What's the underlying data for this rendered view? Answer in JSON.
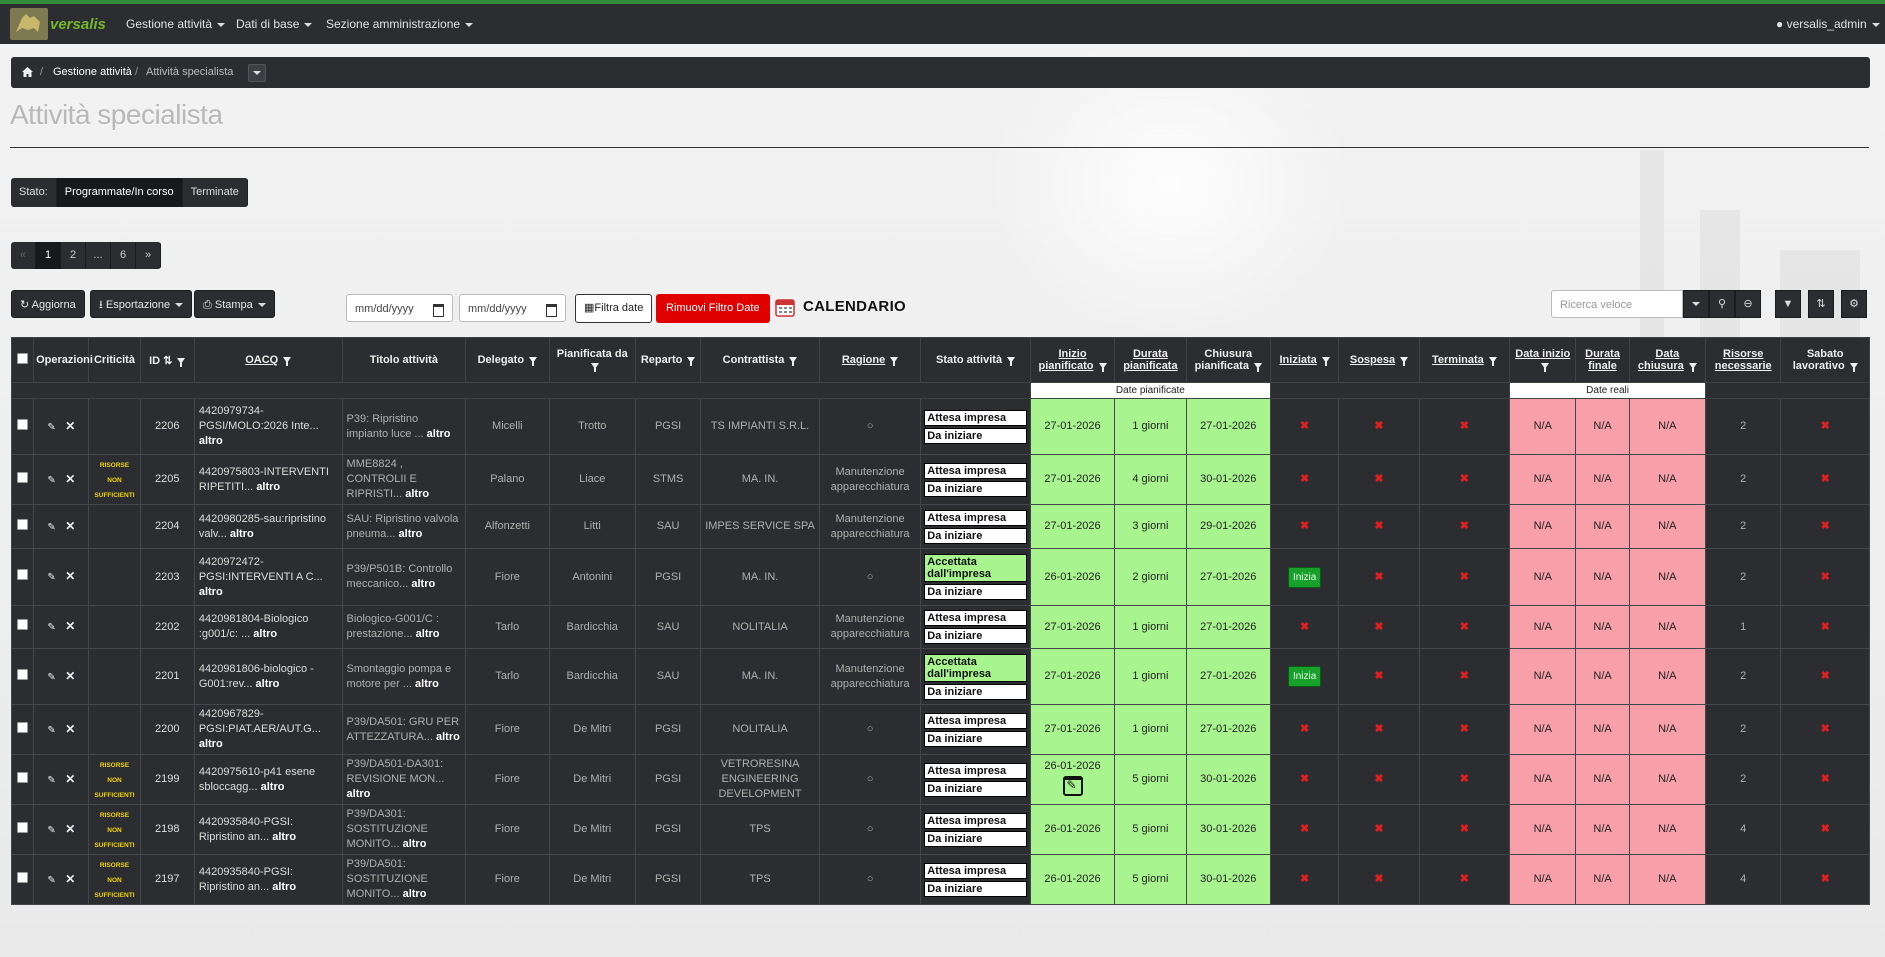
{
  "nav": {
    "brand": "versalis",
    "menus": [
      "Gestione attività",
      "Dati di base",
      "Sezione amministrazione"
    ],
    "user": "versalis_admin"
  },
  "breadcrumb": {
    "items": [
      "Gestione attività",
      "Attività specialista"
    ]
  },
  "page": {
    "title": "Attività specialista"
  },
  "stato": {
    "label": "Stato:",
    "options": [
      "Programmate/In corso",
      "Terminate"
    ],
    "selected": "Programmate/In corso"
  },
  "pager": {
    "prev": "«",
    "pages": [
      "1",
      "2",
      "...",
      "6"
    ],
    "next": "»",
    "current": "1"
  },
  "toolbar": {
    "aggiorna": "Aggiorna",
    "esportazione": "Esportazione",
    "stampa": "Stampa",
    "date_placeholder_from": "mm/dd/yyyy",
    "date_placeholder_to": "mm/dd/yyyy",
    "filtra_date": "Filtra date",
    "rimuovi_filtro": "Rimuovi Filtro Date",
    "calendario": "CALENDARIO",
    "search_placeholder": "Ricerca veloce"
  },
  "table": {
    "headers": [
      "Operazioni",
      "Criticità",
      "ID",
      "OACQ",
      "Titolo attività",
      "Delegato",
      "Pianificata da",
      "Reparto",
      "Contrattista",
      "Ragione",
      "Stato attività",
      "Inizio pianificato",
      "Durata pianificata",
      "Chiusura pianificata",
      "Iniziata",
      "Sospesa",
      "Terminata",
      "Data inizio",
      "Durata finale",
      "Data chiusura",
      "Risorse necessarie",
      "Sabato lavorativo"
    ],
    "group_planned": "Date pianificate",
    "group_real": "Date reali",
    "altro": "altro",
    "risorse_text": "RISORSE NON SUFFICIENTI",
    "rows": [
      {
        "id": "2206",
        "risorse": false,
        "oacq": "4420979734-PGSI/MOLO:2026 Inte...",
        "titolo": "P39: Ripristino impianto luce ...",
        "delegato": "Micelli",
        "pianificata": "Trotto",
        "reparto": "PGSI",
        "contrattista": "TS IMPIANTI S.R.L.",
        "ragione": "○",
        "stato1": "Attesa impresa",
        "stato2": "Da iniziare",
        "stato1_green": false,
        "inizio": "27-01-2026",
        "durata": "1 giorni",
        "chiusura": "27-01-2026",
        "iniziata_btn": false,
        "data_inizio": "N/A",
        "durata_finale": "N/A",
        "data_chiusura": "N/A",
        "risorse_n": "2"
      },
      {
        "id": "2205",
        "risorse": true,
        "oacq": "4420975803-INTERVENTI RIPETITI...",
        "titolo": "MME8824 , CONTROLII E RIPRISTI...",
        "delegato": "Palano",
        "pianificata": "Liace",
        "reparto": "STMS",
        "contrattista": "MA. IN.",
        "ragione": "Manutenzione apparecchiatura",
        "stato1": "Attesa impresa",
        "stato2": "Da iniziare",
        "stato1_green": false,
        "inizio": "27-01-2026",
        "durata": "4 giorni",
        "chiusura": "30-01-2026",
        "iniziata_btn": false,
        "data_inizio": "N/A",
        "durata_finale": "N/A",
        "data_chiusura": "N/A",
        "risorse_n": "2"
      },
      {
        "id": "2204",
        "risorse": false,
        "oacq": "4420980285-sau:ripristino valv...",
        "titolo": "SAU: Ripristino valvola pneuma...",
        "delegato": "Alfonzetti",
        "pianificata": "Litti",
        "reparto": "SAU",
        "contrattista": "IMPES SERVICE SPA",
        "ragione": "Manutenzione apparecchiatura",
        "stato1": "Attesa impresa",
        "stato2": "Da iniziare",
        "stato1_green": false,
        "inizio": "27-01-2026",
        "durata": "3 giorni",
        "chiusura": "29-01-2026",
        "iniziata_btn": false,
        "data_inizio": "N/A",
        "durata_finale": "N/A",
        "data_chiusura": "N/A",
        "risorse_n": "2"
      },
      {
        "id": "2203",
        "risorse": false,
        "oacq": "4420972472-PGSI:INTERVENTI A C...",
        "titolo": "P39/P501B: Controllo meccanico...",
        "delegato": "Fiore",
        "pianificata": "Antonini",
        "reparto": "PGSI",
        "contrattista": "MA. IN.",
        "ragione": "○",
        "stato1": "Accettata dall'impresa",
        "stato2": "Da iniziare",
        "stato1_green": true,
        "inizio": "26-01-2026",
        "durata": "2 giorni",
        "chiusura": "27-01-2026",
        "iniziata_btn": true,
        "data_inizio": "N/A",
        "durata_finale": "N/A",
        "data_chiusura": "N/A",
        "risorse_n": "2"
      },
      {
        "id": "2202",
        "risorse": false,
        "oacq": "4420981804-Biologico :g001/c: ...",
        "titolo": "Biologico-G001/C : prestazione...",
        "delegato": "Tarlo",
        "pianificata": "Bardicchia",
        "reparto": "SAU",
        "contrattista": "NOLITALIA",
        "ragione": "Manutenzione apparecchiatura",
        "stato1": "Attesa impresa",
        "stato2": "Da iniziare",
        "stato1_green": false,
        "inizio": "27-01-2026",
        "durata": "1 giorni",
        "chiusura": "27-01-2026",
        "iniziata_btn": false,
        "data_inizio": "N/A",
        "durata_finale": "N/A",
        "data_chiusura": "N/A",
        "risorse_n": "1"
      },
      {
        "id": "2201",
        "risorse": false,
        "oacq": "4420981806-biologico - G001:rev...",
        "titolo": "Smontaggio pompa e motore per ...",
        "delegato": "Tarlo",
        "pianificata": "Bardicchia",
        "reparto": "SAU",
        "contrattista": "MA. IN.",
        "ragione": "Manutenzione apparecchiatura",
        "stato1": "Accettata dall'impresa",
        "stato2": "Da iniziare",
        "stato1_green": true,
        "inizio": "27-01-2026",
        "durata": "1 giorni",
        "chiusura": "27-01-2026",
        "iniziata_btn": true,
        "data_inizio": "N/A",
        "durata_finale": "N/A",
        "data_chiusura": "N/A",
        "risorse_n": "2"
      },
      {
        "id": "2200",
        "risorse": false,
        "oacq": "4420967829-PGSI:PIAT.AER/AUT.G...",
        "titolo": "P39/DA501: GRU PER ATTEZZATURA...",
        "delegato": "Fiore",
        "pianificata": "De Mitri",
        "reparto": "PGSI",
        "contrattista": "NOLITALIA",
        "ragione": "○",
        "stato1": "Attesa impresa",
        "stato2": "Da iniziare",
        "stato1_green": false,
        "inizio": "27-01-2026",
        "durata": "1 giorni",
        "chiusura": "27-01-2026",
        "iniziata_btn": false,
        "data_inizio": "N/A",
        "durata_finale": "N/A",
        "data_chiusura": "N/A",
        "risorse_n": "2"
      },
      {
        "id": "2199",
        "risorse": true,
        "oacq": "4420975610-p41 esene sbloccagg...",
        "titolo": "P39/DA501-DA301: REVISIONE MON...",
        "delegato": "Fiore",
        "pianificata": "De Mitri",
        "reparto": "PGSI",
        "contrattista": "VETRORESINA ENGINEERING DEVELOPMENT",
        "ragione": "○",
        "stato1": "Attesa impresa",
        "stato2": "Da iniziare",
        "stato1_green": false,
        "inizio": "26-01-2026",
        "edit_cal": true,
        "durata": "5 giorni",
        "chiusura": "30-01-2026",
        "iniziata_btn": false,
        "data_inizio": "N/A",
        "durata_finale": "N/A",
        "data_chiusura": "N/A",
        "risorse_n": "2"
      },
      {
        "id": "2198",
        "risorse": true,
        "oacq": "4420935840-PGSI: Ripristino an...",
        "titolo": "P39/DA301: SOSTITUZIONE MONITO...",
        "delegato": "Fiore",
        "pianificata": "De Mitri",
        "reparto": "PGSI",
        "contrattista": "TPS",
        "ragione": "○",
        "stato1": "Attesa impresa",
        "stato2": "Da iniziare",
        "stato1_green": false,
        "inizio": "26-01-2026",
        "durata": "5 giorni",
        "chiusura": "30-01-2026",
        "iniziata_btn": false,
        "data_inizio": "N/A",
        "durata_finale": "N/A",
        "data_chiusura": "N/A",
        "risorse_n": "4"
      },
      {
        "id": "2197",
        "risorse": true,
        "oacq": "4420935840-PGSI: Ripristino an...",
        "titolo": "P39/DA501: SOSTITUZIONE MONITO...",
        "delegato": "Fiore",
        "pianificata": "De Mitri",
        "reparto": "PGSI",
        "contrattista": "TPS",
        "ragione": "○",
        "stato1": "Attesa impresa",
        "stato2": "Da iniziare",
        "stato1_green": false,
        "inizio": "26-01-2026",
        "durata": "5 giorni",
        "chiusura": "30-01-2026",
        "iniziata_btn": false,
        "data_inizio": "N/A",
        "durata_finale": "N/A",
        "data_chiusura": "N/A",
        "risorse_n": "4"
      }
    ]
  },
  "colors": {
    "dark": "#2b2d30",
    "green_cell": "#a8f58f",
    "pink_cell": "#f7a0a9",
    "red_button": "#e00000",
    "brand_green": "#76b82a"
  }
}
